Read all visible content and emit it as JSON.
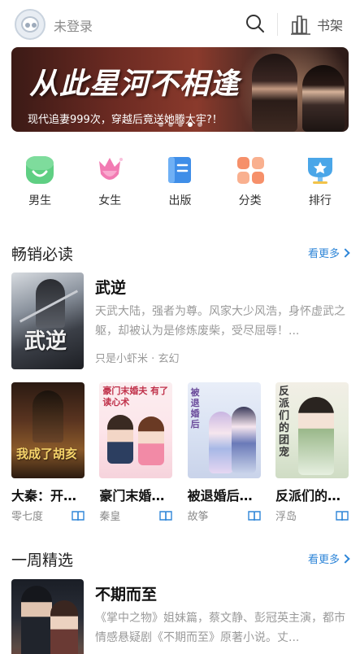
{
  "header": {
    "login_text": "未登录",
    "search_icon": "search-icon",
    "shelf_label": "书架",
    "shelf_icon": "bookshelf-icon"
  },
  "banner": {
    "title": "从此星河不相逢",
    "subtitle": "现代追妻999次，穿越后竟送她腾大牢?！",
    "dot_count": 5,
    "active_dot": 3
  },
  "categories": [
    {
      "label": "男生",
      "icon": "male-icon",
      "color": "#5fcf83"
    },
    {
      "label": "女生",
      "icon": "female-icon",
      "color": "#f27bb3"
    },
    {
      "label": "出版",
      "icon": "book-icon",
      "color": "#3f8ee8"
    },
    {
      "label": "分类",
      "icon": "category-icon",
      "color": "#f6906a"
    },
    {
      "label": "排行",
      "icon": "ranking-icon",
      "color": "#4aa6e8"
    }
  ],
  "bestseller": {
    "title": "畅销必读",
    "more_label": "看更多",
    "featured": {
      "title": "武逆",
      "cover_text": "武逆",
      "description": "天武大陆，强者为尊。风家大少风浩，身怀虚武之躯，却被认为是修炼废柴，受尽屈辱！...",
      "author": "只是小虾米",
      "genre": "玄幻",
      "separator": "·"
    },
    "books": [
      {
        "title": "大秦：开局...",
        "author": "零七度",
        "cover_text": "我成了胡亥"
      },
      {
        "title": "豪门末婚夫...",
        "author": "秦皇",
        "cover_text": "豪门末婚夫 有了读心术"
      },
      {
        "title": "被退婚后我...",
        "author": "故筝",
        "cover_text": "被退婚后"
      },
      {
        "title": "反派们的团...",
        "author": "浮岛",
        "cover_text": "反派们的团宠"
      }
    ]
  },
  "weekly": {
    "title": "一周精选",
    "more_label": "看更多",
    "featured": {
      "title": "不期而至",
      "description": "《掌中之物》姐妹篇，蔡文静、彭冠英主演，都市情感悬疑剧《不期而至》原著小说。丈..."
    }
  },
  "colors": {
    "accent": "#2f86d8",
    "muted_text": "#9a9a9a"
  }
}
